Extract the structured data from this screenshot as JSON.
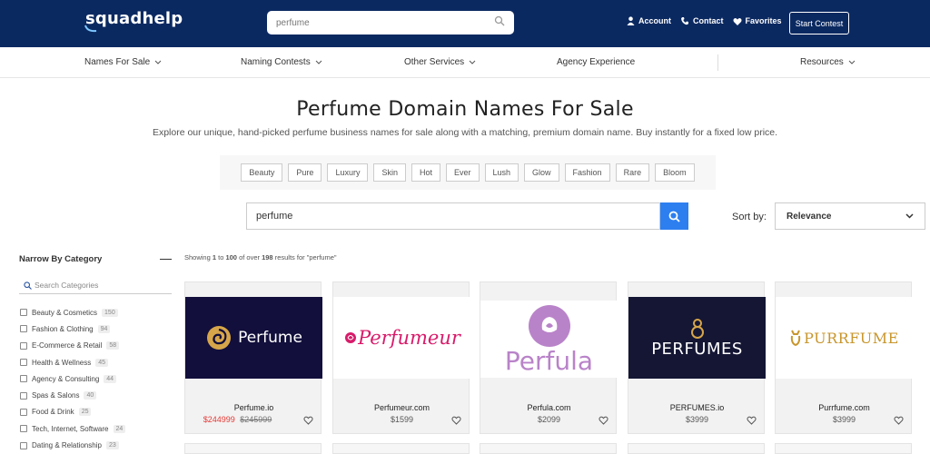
{
  "header": {
    "logo": "squadhelp",
    "search_value": "perfume",
    "links": [
      "Account",
      "Contact",
      "Favorites"
    ],
    "start_contest": "Start Contest"
  },
  "nav": {
    "items": [
      "Names For Sale",
      "Naming Contests",
      "Other Services",
      "Agency Experience",
      "Resources"
    ]
  },
  "hero": {
    "title": "Perfume Domain Names For Sale",
    "subtitle": "Explore our unique, hand-picked perfume business names for sale along with a matching, premium domain name. Buy instantly for a fixed low price."
  },
  "tags": [
    "Beauty",
    "Pure",
    "Luxury",
    "Skin",
    "Hot",
    "Ever",
    "Lush",
    "Glow",
    "Fashion",
    "Rare",
    "Bloom"
  ],
  "search": {
    "value": "perfume"
  },
  "sort": {
    "label": "Sort by:",
    "value": "Relevance"
  },
  "sidebar": {
    "title": "Narrow By Category",
    "search_placeholder": "Search Categories",
    "categories": [
      {
        "label": "Beauty & Cosmetics",
        "count": "150"
      },
      {
        "label": "Fashion & Clothing",
        "count": "94"
      },
      {
        "label": "E-Commerce & Retail",
        "count": "58"
      },
      {
        "label": "Health & Wellness",
        "count": "45"
      },
      {
        "label": "Agency & Consulting",
        "count": "44"
      },
      {
        "label": "Spas & Salons",
        "count": "40"
      },
      {
        "label": "Food & Drink",
        "count": "25"
      },
      {
        "label": "Tech, Internet, Software",
        "count": "24"
      },
      {
        "label": "Dating & Relationship",
        "count": "23"
      }
    ]
  },
  "results": {
    "prefix": "Showing ",
    "from": "1",
    "to_word": " to ",
    "to": "100",
    "of_word": " of over ",
    "total": "198",
    "suffix": " results for \"perfume\""
  },
  "cards": [
    {
      "name": "Perfume.io",
      "price": "$244999",
      "old_price": "$245999",
      "logo_text": "Perfume",
      "bg": "#120f3c"
    },
    {
      "name": "Perfumeur.com",
      "price": "$1599",
      "logo_text": "Perfumeur",
      "bg": "#ffffff"
    },
    {
      "name": "Perfula.com",
      "price": "$2099",
      "logo_text": "Perfula",
      "bg": "#ffffff"
    },
    {
      "name": "PERFUMES.io",
      "price": "$3999",
      "logo_text": "PERFUMES",
      "bg": "#141634"
    },
    {
      "name": "Purrfume.com",
      "price": "$3999",
      "logo_text": "PURRFUME",
      "bg": "#ffffff"
    }
  ],
  "colors": {
    "navy": "#0b2961",
    "accent": "#2d7ff0",
    "sale_red": "#e53935"
  }
}
